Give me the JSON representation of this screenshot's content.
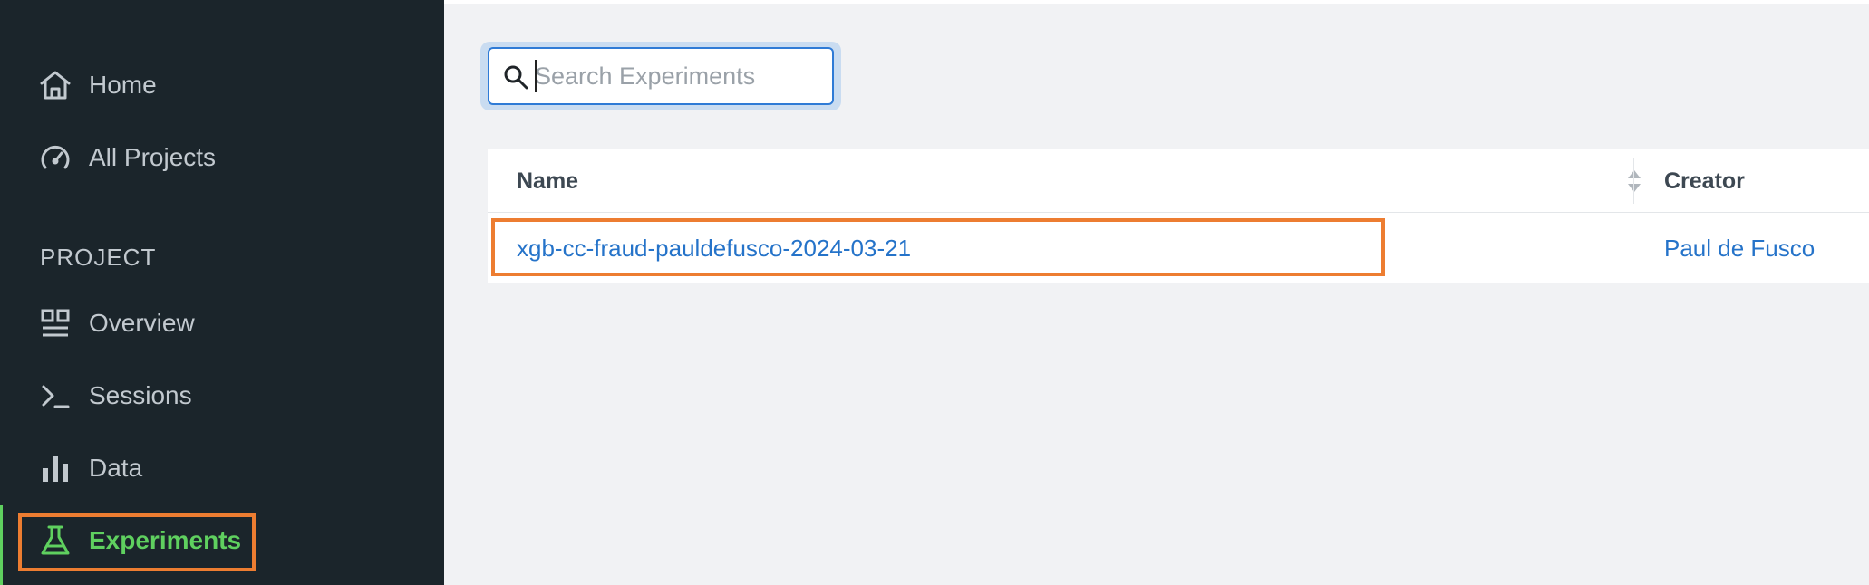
{
  "sidebar": {
    "nav": {
      "home": {
        "label": "Home",
        "icon": "home-icon"
      },
      "all_projects": {
        "label": "All Projects",
        "icon": "gauge-icon"
      }
    },
    "section_label": "PROJECT",
    "project_nav": {
      "overview": {
        "label": "Overview",
        "icon": "dashboard-icon"
      },
      "sessions": {
        "label": "Sessions",
        "icon": "terminal-icon"
      },
      "data": {
        "label": "Data",
        "icon": "bar-chart-icon"
      },
      "experiments": {
        "label": "Experiments",
        "icon": "flask-icon",
        "active": true
      }
    },
    "active_color": "#5fd05f",
    "background": "#1b252b"
  },
  "search": {
    "placeholder": "Search Experiments",
    "value": ""
  },
  "table": {
    "columns": [
      "Name",
      "Creator"
    ],
    "rows": [
      {
        "name": "xgb-cc-fraud-pauldefusco-2024-03-21",
        "creator": "Paul de Fusco"
      }
    ]
  },
  "colors": {
    "highlight": "#ed7d31",
    "link": "#2573c9",
    "accent": "#2f7bd6"
  }
}
